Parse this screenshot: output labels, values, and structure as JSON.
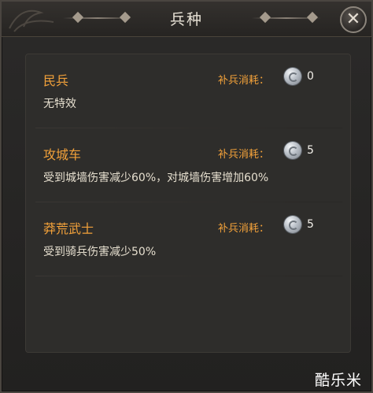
{
  "window": {
    "title": "兵种",
    "close_icon": "close-x-icon"
  },
  "units": [
    {
      "name": "民兵",
      "desc": "无特效",
      "cost_label": "补兵消耗：",
      "cost_value": "0",
      "cost_icon": "silver-coin-icon"
    },
    {
      "name": "攻城车",
      "desc": "受到城墙伤害减少60%，对城墙伤害增加60%",
      "cost_label": "补兵消耗：",
      "cost_value": "5",
      "cost_icon": "silver-coin-icon"
    },
    {
      "name": "莽荒武士",
      "desc": "受到骑兵伤害减少50%",
      "cost_label": "补兵消耗：",
      "cost_value": "5",
      "cost_icon": "silver-coin-icon"
    }
  ],
  "watermark": "酷乐米",
  "colors": {
    "accent": "#f2a13a",
    "text": "#e6dfcf",
    "background": "#2b2a29"
  }
}
